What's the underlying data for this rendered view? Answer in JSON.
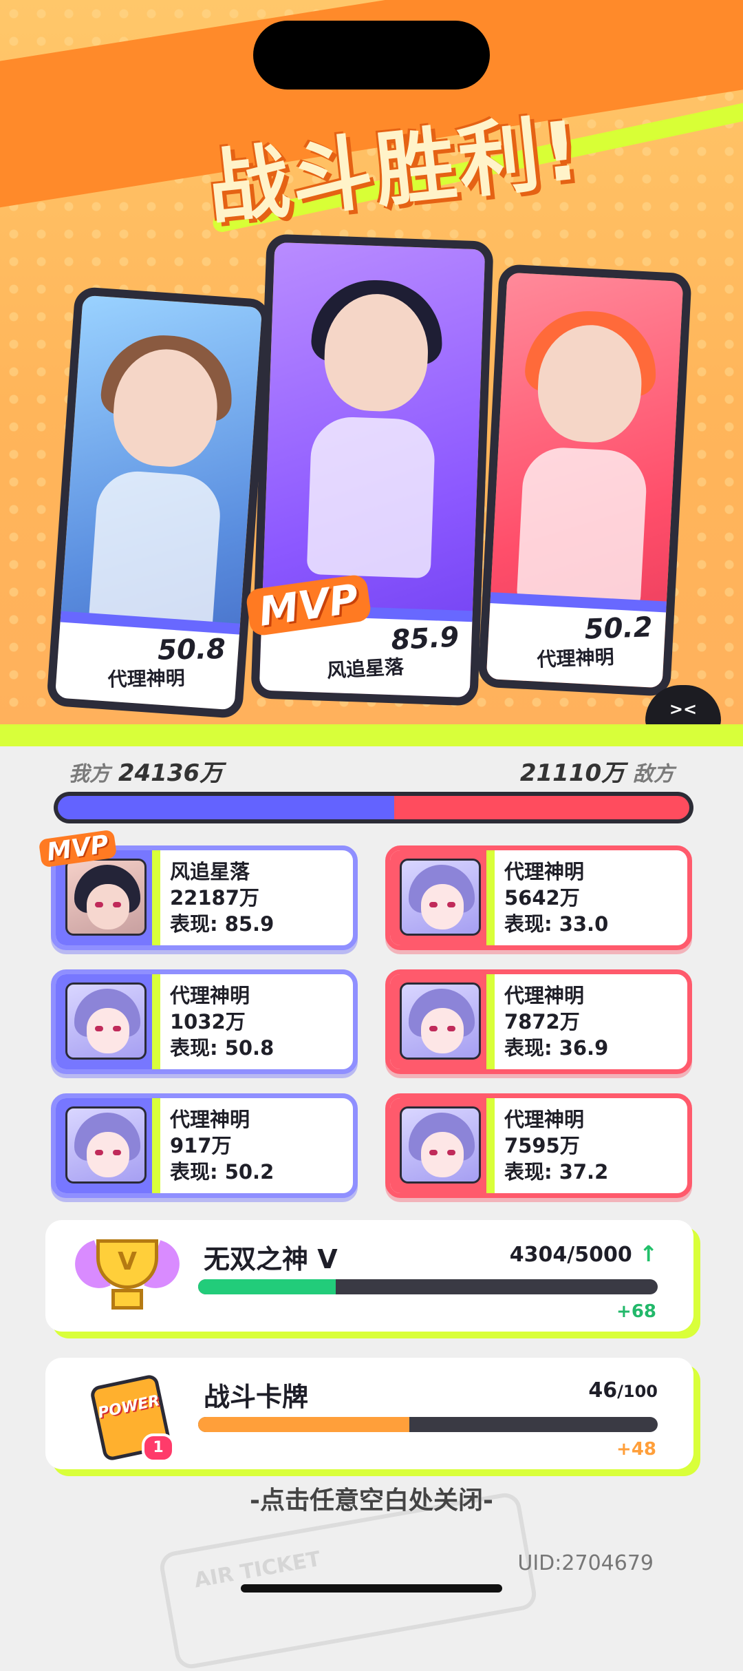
{
  "header": {
    "title": "战斗胜利!"
  },
  "mvp_label": "MVP",
  "heroes": [
    {
      "name": "代理神明",
      "score": "50.8"
    },
    {
      "name": "风追星落",
      "score": "85.9",
      "mvp": true
    },
    {
      "name": "代理神明",
      "score": "50.2"
    }
  ],
  "scoreboard": {
    "our_label": "我方",
    "our_score": "24136万",
    "enemy_label": "敌方",
    "enemy_score": "21110万",
    "our_share": 0.533
  },
  "players": {
    "ours": [
      {
        "name": "风追星落",
        "damage": "22187万",
        "perf": "表现: 85.9",
        "mvp": true
      },
      {
        "name": "代理神明",
        "damage": "1032万",
        "perf": "表现: 50.8"
      },
      {
        "name": "代理神明",
        "damage": "917万",
        "perf": "表现: 50.2"
      }
    ],
    "enemies": [
      {
        "name": "代理神明",
        "damage": "5642万",
        "perf": "表现: 33.0"
      },
      {
        "name": "代理神明",
        "damage": "7872万",
        "perf": "表现: 36.9"
      },
      {
        "name": "代理神明",
        "damage": "7595万",
        "perf": "表现: 37.2"
      }
    ]
  },
  "rank_panel": {
    "title": "无双之神 V",
    "progress": "4304/5000",
    "fraction": 0.3,
    "increase": "+68",
    "bar_color": "#22cc7a",
    "icon": "trophy-icon",
    "trophy_letter": "V"
  },
  "card_panel": {
    "title": "战斗卡牌",
    "current": "46",
    "total": "/100",
    "fraction": 0.46,
    "increase": "+48",
    "bar_color": "#ff9f3a",
    "icon": "power-card-icon",
    "card_text": "POWER",
    "badge": "1"
  },
  "footer": {
    "close_hint": "-点击任意空白处关闭-",
    "uid": "UID:2704679"
  },
  "bot_face": "><"
}
